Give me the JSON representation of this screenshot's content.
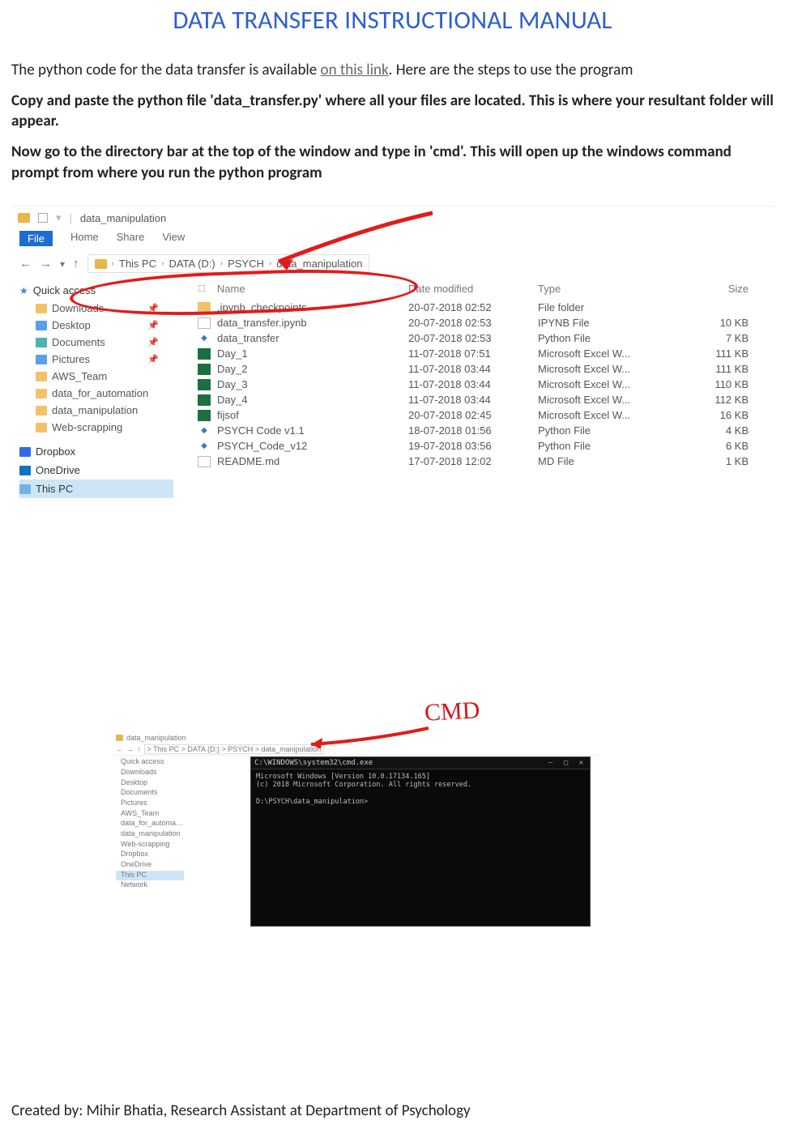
{
  "title": "DATA TRANSFER INSTRUCTIONAL MANUAL",
  "para1a": "The python code for the data transfer is available ",
  "link_text": "on this link",
  "para1b": ". Here are the steps to use the program",
  "para2": "Copy and paste the python file 'data_transfer.py' where all your files are located. This is where your resultant folder will appear.",
  "para3": "Now go to the directory bar at the top of the window and type in 'cmd'. This will open up the windows command prompt from where you run the python program",
  "footer": "Created by: Mihir Bhatia, Research Assistant at Department of Psychology",
  "explorer": {
    "window_title": "data_manipulation",
    "ribbon": {
      "file": "File",
      "home": "Home",
      "share": "Share",
      "view": "View"
    },
    "breadcrumb": {
      "pc": "This PC",
      "drive": "DATA (D:)",
      "f1": "PSYCH",
      "f2": "data_manipulation"
    },
    "sidebar": {
      "quick": "Quick access",
      "downloads": "Downloads",
      "desktop": "Desktop",
      "documents": "Documents",
      "pictures": "Pictures",
      "aws": "AWS_Team",
      "dfa": "data_for_automation",
      "dm": "data_manipulation",
      "ws": "Web-scrapping",
      "dropbox": "Dropbox",
      "onedrive": "OneDrive",
      "thispc": "This PC"
    },
    "cols": {
      "name": "Name",
      "date": "Date modified",
      "type": "Type",
      "size": "Size"
    },
    "rows": [
      {
        "name": ".ipynb_checkpoints",
        "date": "20-07-2018 02:52",
        "type": "File folder",
        "size": "",
        "icon": "folder"
      },
      {
        "name": "data_transfer.ipynb",
        "date": "20-07-2018 02:53",
        "type": "IPYNB File",
        "size": "10 KB",
        "icon": "ipynb"
      },
      {
        "name": "data_transfer",
        "date": "20-07-2018 02:53",
        "type": "Python File",
        "size": "7 KB",
        "icon": "py"
      },
      {
        "name": "Day_1",
        "date": "11-07-2018 07:51",
        "type": "Microsoft Excel W...",
        "size": "111 KB",
        "icon": "excel"
      },
      {
        "name": "Day_2",
        "date": "11-07-2018 03:44",
        "type": "Microsoft Excel W...",
        "size": "111 KB",
        "icon": "excel"
      },
      {
        "name": "Day_3",
        "date": "11-07-2018 03:44",
        "type": "Microsoft Excel W...",
        "size": "110 KB",
        "icon": "excel"
      },
      {
        "name": "Day_4",
        "date": "11-07-2018 03:44",
        "type": "Microsoft Excel W...",
        "size": "112 KB",
        "icon": "excel"
      },
      {
        "name": "fijsof",
        "date": "20-07-2018 02:45",
        "type": "Microsoft Excel W...",
        "size": "16 KB",
        "icon": "excel"
      },
      {
        "name": "PSYCH Code  v1.1",
        "date": "18-07-2018 01:56",
        "type": "Python File",
        "size": "4 KB",
        "icon": "py"
      },
      {
        "name": "PSYCH_Code_v12",
        "date": "19-07-2018 03:56",
        "type": "Python File",
        "size": "6 KB",
        "icon": "py"
      },
      {
        "name": "README.md",
        "date": "17-07-2018 12:02",
        "type": "MD File",
        "size": "1 KB",
        "icon": "md"
      }
    ]
  },
  "annotation": {
    "cmd_label": "CMD"
  },
  "cmd": {
    "title": "C:\\WINDOWS\\system32\\cmd.exe",
    "line1": "Microsoft Windows [Version 10.0.17134.165]",
    "line2": "(c) 2018 Microsoft Corporation. All rights reserved.",
    "line3": "D:\\PSYCH\\data_manipulation>"
  },
  "mini": {
    "crumb": "> This PC > DATA (D:) > PSYCH > data_manipulation",
    "side": [
      "Quick access",
      "Downloads",
      "Desktop",
      "Documents",
      "Pictures",
      "AWS_Team",
      "data_for_automation",
      "data_manipulation",
      "Web-scrapping",
      "Dropbox",
      "OneDrive",
      "This PC",
      "Network"
    ]
  }
}
